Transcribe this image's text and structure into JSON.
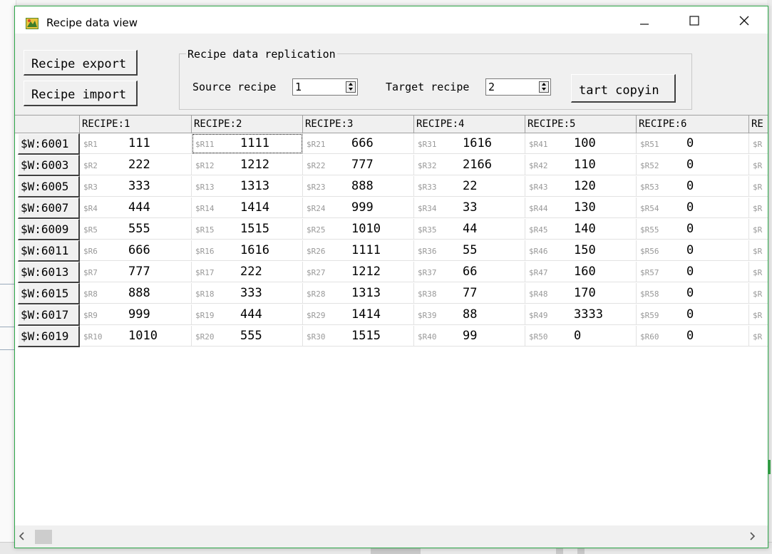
{
  "window": {
    "title": "Recipe data view"
  },
  "toolbar": {
    "export_label": "Recipe export",
    "import_label": "Recipe import",
    "replication_legend": "Recipe data replication",
    "source_label": "Source recipe",
    "source_value": "1",
    "target_label": "Target recipe",
    "target_value": "2",
    "copy_label": "tart copyin"
  },
  "table": {
    "columns": [
      "RECIPE:1",
      "RECIPE:2",
      "RECIPE:3",
      "RECIPE:4",
      "RECIPE:5",
      "RECIPE:6",
      "RE"
    ],
    "row_headers": [
      "$W:6001",
      "$W:6003",
      "$W:6005",
      "$W:6007",
      "$W:6009",
      "$W:6011",
      "$W:6013",
      "$W:6015",
      "$W:6017",
      "$W:6019"
    ],
    "rows": [
      [
        [
          "$R1",
          "111"
        ],
        [
          "$R11",
          "1111"
        ],
        [
          "$R21",
          "666"
        ],
        [
          "$R31",
          "1616"
        ],
        [
          "$R41",
          "100"
        ],
        [
          "$R51",
          "0"
        ],
        [
          "$R",
          ""
        ]
      ],
      [
        [
          "$R2",
          "222"
        ],
        [
          "$R12",
          "1212"
        ],
        [
          "$R22",
          "777"
        ],
        [
          "$R32",
          "2166"
        ],
        [
          "$R42",
          "110"
        ],
        [
          "$R52",
          "0"
        ],
        [
          "$R",
          ""
        ]
      ],
      [
        [
          "$R3",
          "333"
        ],
        [
          "$R13",
          "1313"
        ],
        [
          "$R23",
          "888"
        ],
        [
          "$R33",
          "22"
        ],
        [
          "$R43",
          "120"
        ],
        [
          "$R53",
          "0"
        ],
        [
          "$R",
          ""
        ]
      ],
      [
        [
          "$R4",
          "444"
        ],
        [
          "$R14",
          "1414"
        ],
        [
          "$R24",
          "999"
        ],
        [
          "$R34",
          "33"
        ],
        [
          "$R44",
          "130"
        ],
        [
          "$R54",
          "0"
        ],
        [
          "$R",
          ""
        ]
      ],
      [
        [
          "$R5",
          "555"
        ],
        [
          "$R15",
          "1515"
        ],
        [
          "$R25",
          "1010"
        ],
        [
          "$R35",
          "44"
        ],
        [
          "$R45",
          "140"
        ],
        [
          "$R55",
          "0"
        ],
        [
          "$R",
          ""
        ]
      ],
      [
        [
          "$R6",
          "666"
        ],
        [
          "$R16",
          "1616"
        ],
        [
          "$R26",
          "1111"
        ],
        [
          "$R36",
          "55"
        ],
        [
          "$R46",
          "150"
        ],
        [
          "$R56",
          "0"
        ],
        [
          "$R",
          ""
        ]
      ],
      [
        [
          "$R7",
          "777"
        ],
        [
          "$R17",
          "222"
        ],
        [
          "$R27",
          "1212"
        ],
        [
          "$R37",
          "66"
        ],
        [
          "$R47",
          "160"
        ],
        [
          "$R57",
          "0"
        ],
        [
          "$R",
          ""
        ]
      ],
      [
        [
          "$R8",
          "888"
        ],
        [
          "$R18",
          "333"
        ],
        [
          "$R28",
          "1313"
        ],
        [
          "$R38",
          "77"
        ],
        [
          "$R48",
          "170"
        ],
        [
          "$R58",
          "0"
        ],
        [
          "$R",
          ""
        ]
      ],
      [
        [
          "$R9",
          "999"
        ],
        [
          "$R19",
          "444"
        ],
        [
          "$R29",
          "1414"
        ],
        [
          "$R39",
          "88"
        ],
        [
          "$R49",
          "3333"
        ],
        [
          "$R59",
          "0"
        ],
        [
          "$R",
          ""
        ]
      ],
      [
        [
          "$R10",
          "1010"
        ],
        [
          "$R20",
          "555"
        ],
        [
          "$R30",
          "1515"
        ],
        [
          "$R40",
          "99"
        ],
        [
          "$R50",
          "0"
        ],
        [
          "$R60",
          "0"
        ],
        [
          "$R",
          ""
        ]
      ]
    ]
  },
  "icons": {
    "app": "recipe-app-icon",
    "minimize": "minimize-icon",
    "maximize": "maximize-icon",
    "close": "close-icon",
    "scroll_left": "scroll-left-icon",
    "scroll_right": "scroll-right-icon"
  }
}
